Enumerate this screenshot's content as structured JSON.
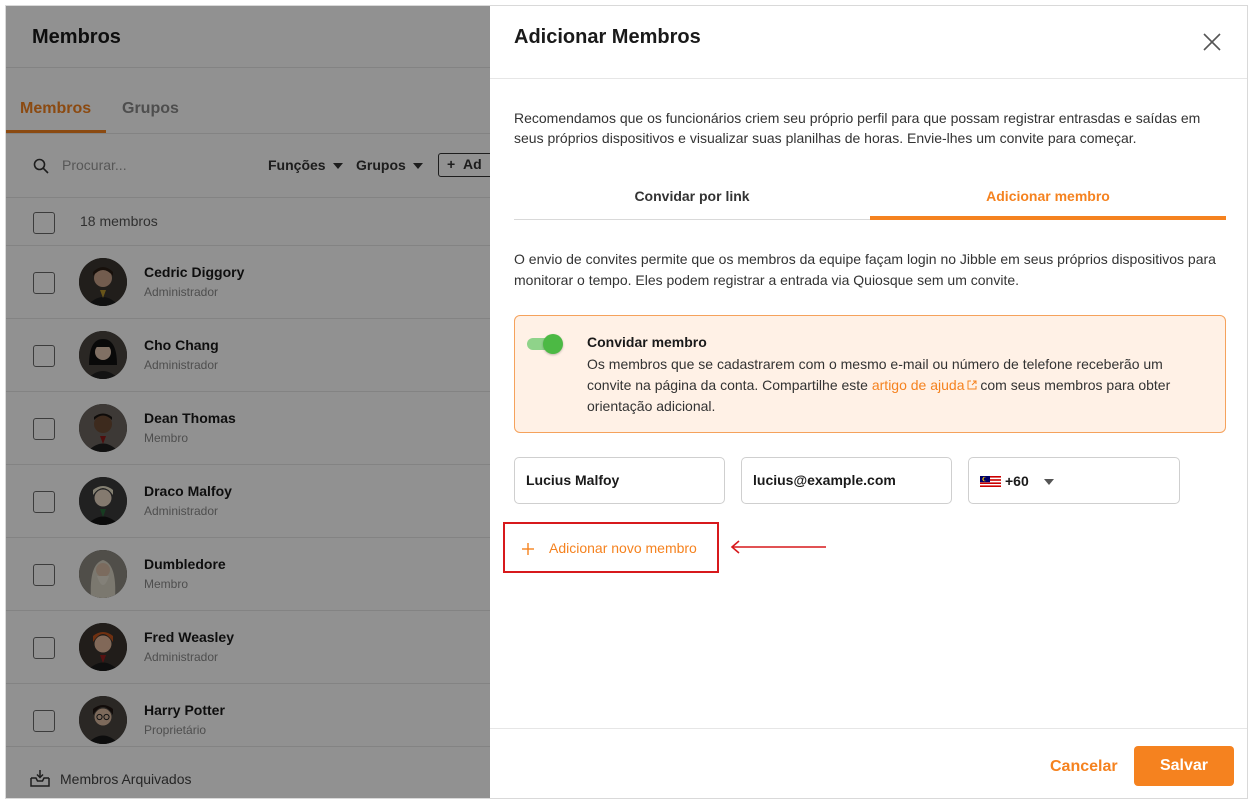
{
  "left": {
    "title": "Membros",
    "tabs": [
      {
        "label": "Membros",
        "active": true
      },
      {
        "label": "Grupos",
        "active": false
      }
    ],
    "search_placeholder": "Procurar...",
    "filters": [
      "Funções",
      "Grupos"
    ],
    "add_label": "Ad",
    "count_label": "18 membros",
    "members": [
      {
        "name": "Cedric Diggory",
        "role": "Administrador"
      },
      {
        "name": "Cho Chang",
        "role": "Administrador"
      },
      {
        "name": "Dean Thomas",
        "role": "Membro"
      },
      {
        "name": "Draco Malfoy",
        "role": "Administrador"
      },
      {
        "name": "Dumbledore",
        "role": "Membro"
      },
      {
        "name": "Fred Weasley",
        "role": "Administrador"
      },
      {
        "name": "Harry Potter",
        "role": "Proprietário"
      }
    ],
    "archived_label": "Membros Arquivados"
  },
  "dialog": {
    "title": "Adicionar Membros",
    "intro": "Recomendamos que os funcionários criem seu próprio perfil para que possam registrar entrasdas e saídas em seus próprios dispositivos e visualizar suas planilhas de horas. Envie-lhes um convite para começar.",
    "mode_tabs": [
      {
        "label": "Convidar por link",
        "active": false
      },
      {
        "label": "Adicionar membro",
        "active": true
      }
    ],
    "description": "O envio de convites permite que os membros da equipe façam login no Jibble em seus próprios dispositivos para monitorar o tempo. Eles podem registrar a entrada via Quiosque sem um convite.",
    "invite": {
      "toggle_on": true,
      "title": "Convidar membro",
      "body_before": "Os membros que se cadastrarem com o mesmo e-mail ou número de telefone receberão um convite na página da conta. Compartilhe este ",
      "link_text": "artigo de ajuda",
      "body_after": " com seus membros para obter orientação adicional."
    },
    "form": {
      "name_value": "Lucius Malfoy",
      "email_value": "lucius@example.com",
      "dial_code": "+60",
      "country_flag": "malaysia-flag"
    },
    "add_new_label": "Adicionar novo membro",
    "cancel_label": "Cancelar",
    "save_label": "Salvar"
  },
  "colors": {
    "accent": "#f5821f",
    "toggle": "#4cb944",
    "highlight_box": "#d7191c",
    "invite_bg": "#fff1e6"
  }
}
